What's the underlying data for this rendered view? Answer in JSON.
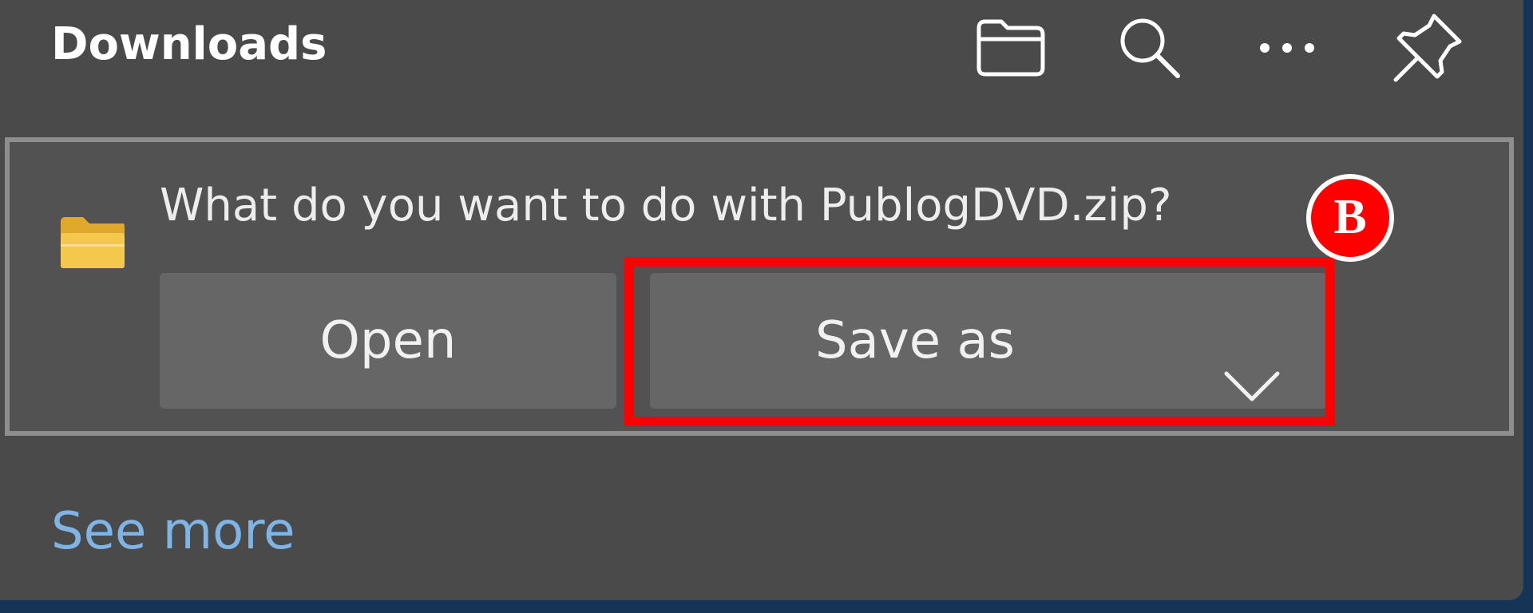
{
  "downloads_panel": {
    "title": "Downloads",
    "header_icons": [
      "folder-icon",
      "search-icon",
      "more-icon",
      "pin-icon"
    ],
    "prompt": {
      "question": "What do you want to do with PublogDVD.zip?",
      "file_icon": "folder-icon",
      "open_label": "Open",
      "save_as_label": "Save as",
      "save_as_dropdown_icon": "chevron-down-icon"
    },
    "see_more_label": "See more"
  },
  "annotation": {
    "marker_label": "B",
    "highlight_color": "#ff0000"
  },
  "colors": {
    "panel_bg": "#4a4a4a",
    "button_bg": "#666666",
    "link": "#7fb4e4",
    "folder_yellow": "#f4c84c"
  }
}
